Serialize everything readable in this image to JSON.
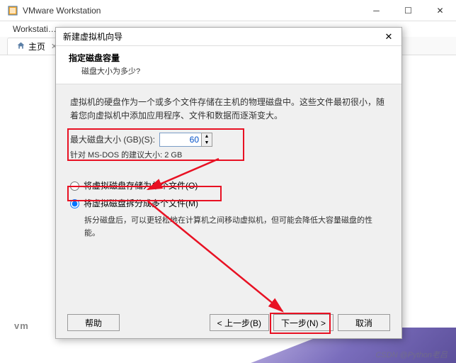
{
  "main_window": {
    "title": "VMware Workstation"
  },
  "main_menu": {
    "workstation": "Workstati…"
  },
  "tabs": {
    "home": "主页"
  },
  "bg_logo": "vm",
  "dialog": {
    "title": "新建虚拟机向导",
    "header_title": "指定磁盘容量",
    "header_sub": "磁盘大小为多少?",
    "description": "虚拟机的硬盘作为一个或多个文件存储在主机的物理磁盘中。这些文件最初很小，随着您向虚拟机中添加应用程序、文件和数据而逐渐变大。",
    "size_label": "最大磁盘大小 (GB)(S):",
    "size_value": "60",
    "rec_text": "针对  MS-DOS 的建议大小: 2 GB",
    "radio1": "将虚拟磁盘存储为单个文件(O)",
    "radio2": "将虚拟磁盘拆分成多个文件(M)",
    "radio_hint": "拆分磁盘后，可以更轻松地在计算机之间移动虚拟机，但可能会降低大容量磁盘的性能。",
    "btn_help": "帮助",
    "btn_back": "< 上一步(B)",
    "btn_next": "下一步(N) >",
    "btn_cancel": "取消"
  },
  "watermark": "CSDN @Python老吕"
}
